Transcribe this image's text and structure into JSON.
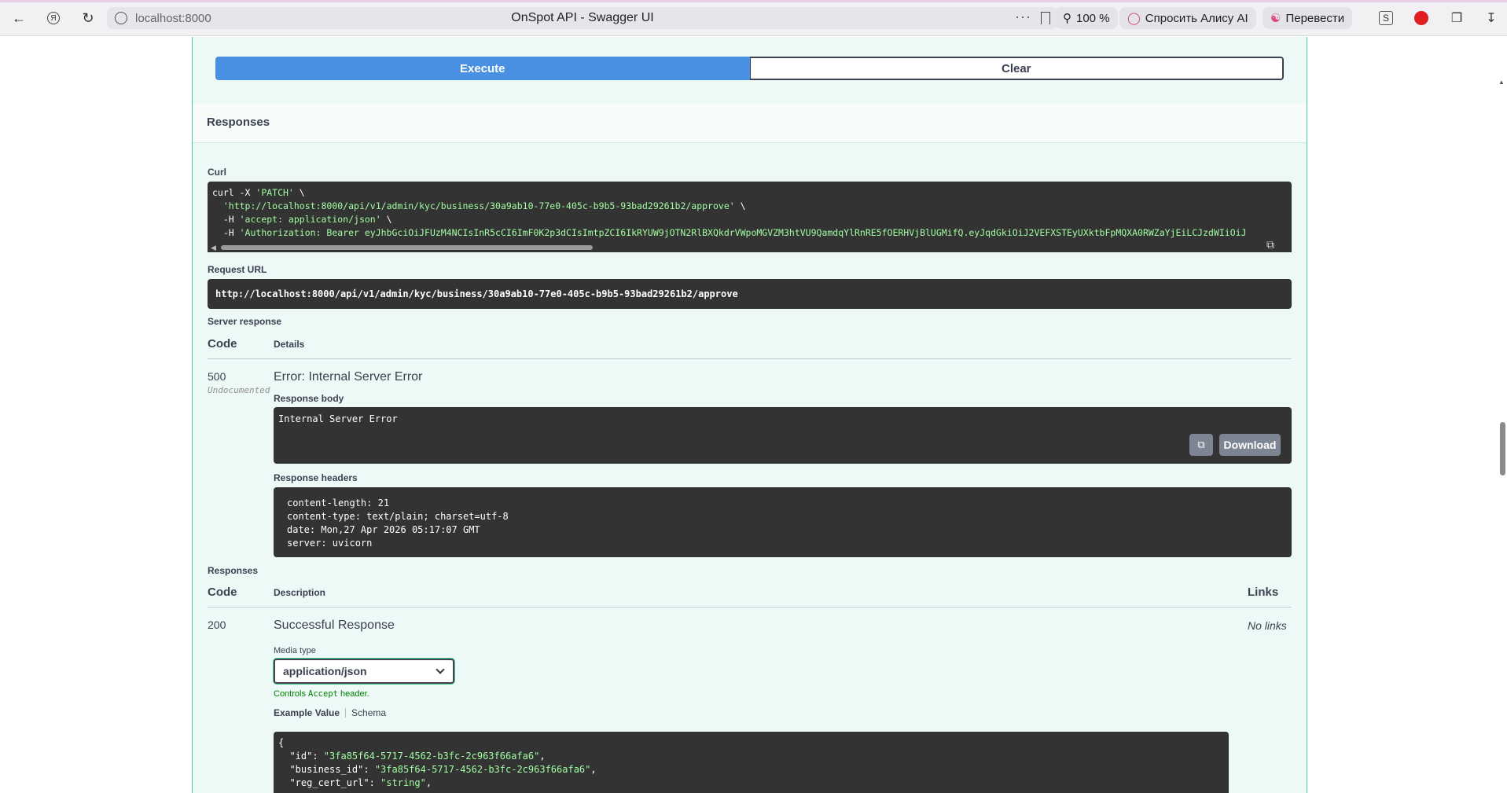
{
  "browser": {
    "url": "localhost:8000",
    "title": "OnSpot API - Swagger UI",
    "zoom": "100 %",
    "alice": "Спросить Алису AI",
    "translate": "Перевести"
  },
  "actions": {
    "execute": "Execute",
    "clear": "Clear"
  },
  "responses_section": {
    "title": "Responses"
  },
  "curl": {
    "label": "Curl",
    "lines": [
      {
        "pre": "curl -X ",
        "str": "'PATCH'",
        "post": " \\"
      },
      {
        "pre": "  ",
        "str": "'http://localhost:8000/api/v1/admin/kyc/business/30a9ab10-77e0-405c-b9b5-93bad29261b2/approve'",
        "post": " \\"
      },
      {
        "pre": "  -H ",
        "str": "'accept: application/json'",
        "post": " \\"
      },
      {
        "pre": "  -H ",
        "str": "'Authorization: Bearer eyJhbGciOiJFUzM4NCIsInR5cCI6ImF0K2p3dCIsImtpZCI6IkRYUW9jOTN2RlBXQkdrVWpoMGVZM3htVU9QamdqYlRnRE5fOERHVjBlUGMifQ.eyJqdGkiOiJ2VEFXSTEyUXktbFpMQXA0RWZaYjEiLCJzdWIiOiJ",
        "post": ""
      }
    ]
  },
  "request_url": {
    "label": "Request URL",
    "value": "http://localhost:8000/api/v1/admin/kyc/business/30a9ab10-77e0-405c-b9b5-93bad29261b2/approve"
  },
  "server_response": {
    "label": "Server response",
    "col_code": "Code",
    "col_details": "Details",
    "code": "500",
    "undocumented": "Undocumented",
    "error_title": "Error: Internal Server Error",
    "body_label": "Response body",
    "body": "Internal Server Error",
    "download": "Download",
    "headers_label": "Response headers",
    "headers": [
      "content-length: 21",
      "content-type: text/plain; charset=utf-8",
      "date: Mon,27 Apr 2026 05:17:07 GMT",
      "server: uvicorn"
    ]
  },
  "documented": {
    "label": "Responses",
    "col_code": "Code",
    "col_description": "Description",
    "col_links": "Links",
    "code": "200",
    "description": "Successful Response",
    "links": "No links",
    "media_label": "Media type",
    "media_value": "application/json",
    "controls_pre": "Controls ",
    "controls_code": "Accept",
    "controls_post": " header.",
    "tab_example": "Example Value",
    "tab_schema": "Schema",
    "example_lines": [
      {
        "pre": "{",
        "str": "",
        "post": ""
      },
      {
        "pre": "  \"id\": ",
        "str": "\"3fa85f64-5717-4562-b3fc-2c963f66afa6\"",
        "post": ","
      },
      {
        "pre": "  \"business_id\": ",
        "str": "\"3fa85f64-5717-4562-b3fc-2c963f66afa6\"",
        "post": ","
      },
      {
        "pre": "  \"reg_cert_url\": ",
        "str": "\"string\"",
        "post": ","
      }
    ]
  }
}
